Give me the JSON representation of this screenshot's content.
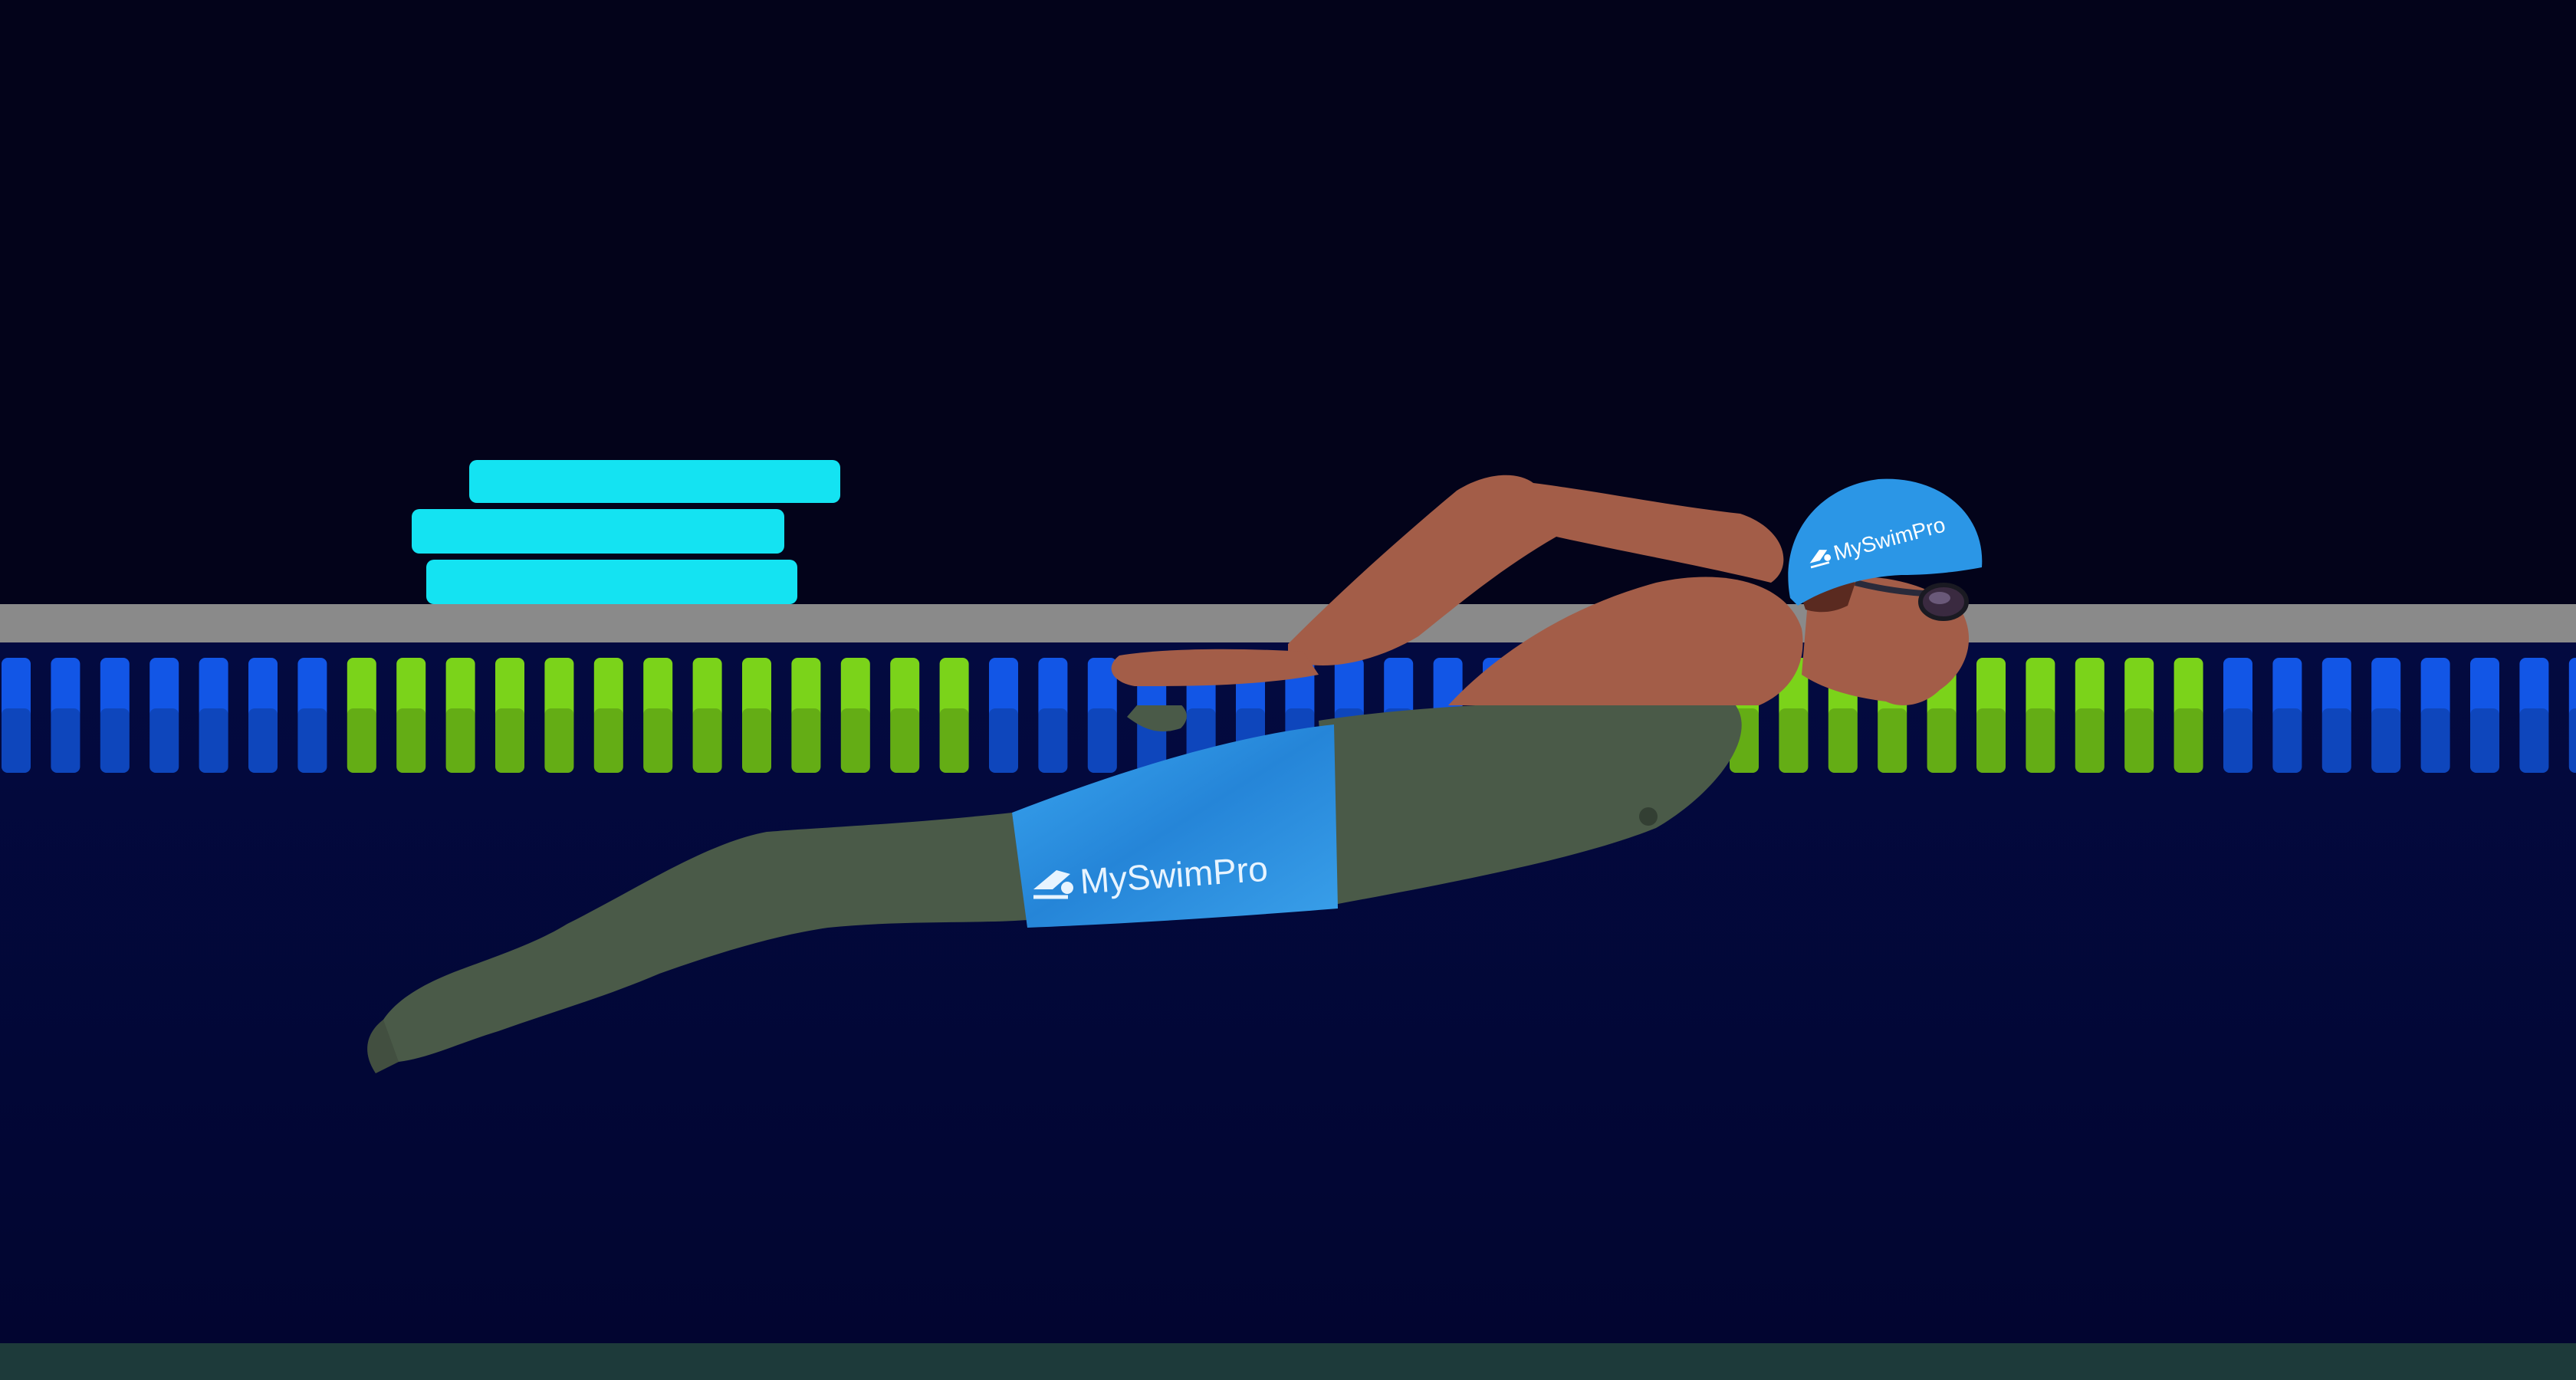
{
  "scene": {
    "cap_brand": "MySwimPro",
    "trunks_brand": "MySwimPro"
  },
  "colors": {
    "sky": "#03031a",
    "water": "#020634",
    "pool_deck": "#8a8a8a",
    "lane_blue": "#1256e6",
    "lane_green": "#7bd31a",
    "kickboard": "#14e3f2",
    "cap": "#2b96e6",
    "trunks": "#2f95e0",
    "skin_above": "#a35d48",
    "skin_below": "#4a5a48",
    "pool_floor": "#1d3a3a"
  },
  "icons": [
    "swimmer-logo-icon"
  ]
}
